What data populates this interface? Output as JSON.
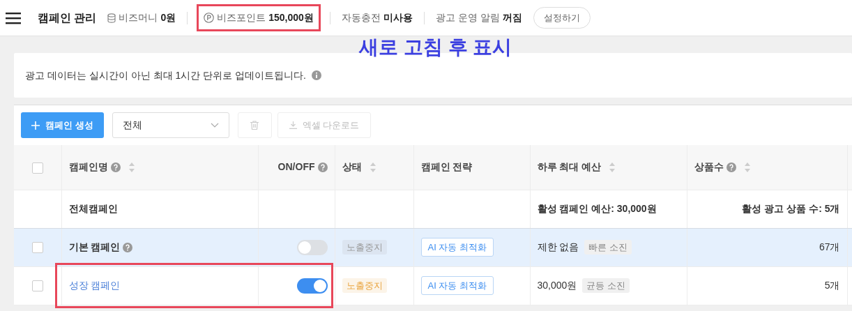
{
  "header": {
    "title": "캠페인 관리",
    "stats": [
      {
        "kind": "money",
        "label": "비즈머니",
        "value": "0원",
        "highlighted": false
      },
      {
        "kind": "point",
        "label": "비즈포인트",
        "value": "150,000원",
        "highlighted": true
      },
      {
        "kind": "plain",
        "label": "자동충전",
        "value": "미사용",
        "highlighted": false
      },
      {
        "kind": "plain",
        "label": "광고 운영 알림",
        "value": "꺼짐",
        "highlighted": false
      }
    ],
    "settings_button": "설정하기"
  },
  "annotation": "새로 고침 후 표시",
  "notice": "광고 데이터는 실시간이 아닌 최대 1시간 단위로 업데이트됩니다.",
  "toolbar": {
    "create_button": "캠페인 생성",
    "filter": "전체",
    "download_button": "엑셀 다운로드"
  },
  "table": {
    "header_checked": false,
    "columns": [
      {
        "label": "캠페인명",
        "help": true,
        "sortable": true
      },
      {
        "label": "ON/OFF",
        "help": true,
        "sortable": false
      },
      {
        "label": "상태",
        "help": false,
        "sortable": true
      },
      {
        "label": "캠페인 전략",
        "help": false,
        "sortable": false
      },
      {
        "label": "하루 최대 예산",
        "help": false,
        "sortable": true
      },
      {
        "label": "상품수",
        "help": true,
        "sortable": true
      }
    ],
    "summary": {
      "name": "전체캠페인",
      "budget": "활성 캠페인 예산: 30,000원",
      "products": "활성 광고 상품 수: 5개"
    },
    "rows": [
      {
        "kind": "default",
        "name": "기본 캠페인",
        "help": true,
        "checked": false,
        "selected": true,
        "on": false,
        "status": "노출중지",
        "color": "#999999",
        "strategy": "AI 자동 최적화",
        "budget": "제한 없음",
        "budget_tag": "빠른 소진",
        "products": "67개",
        "highlighted": false
      },
      {
        "kind": "link",
        "name": "성장 캠페인",
        "help": false,
        "checked": false,
        "selected": false,
        "on": true,
        "status": "노출중지",
        "color": "#e9a43f",
        "strategy": "AI 자동 최적화",
        "budget": "30,000원",
        "budget_tag": "균등 소진",
        "products": "5개",
        "highlighted": true
      }
    ]
  }
}
